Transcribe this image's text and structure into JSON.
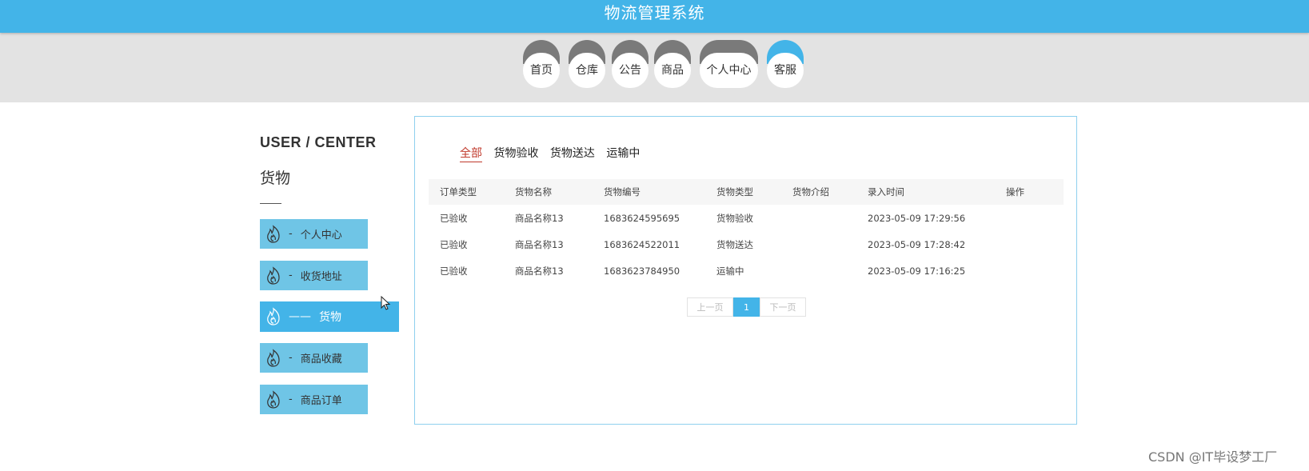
{
  "app_title": "物流管理系统",
  "nav": {
    "items": [
      "首页",
      "仓库",
      "公告",
      "商品",
      "个人中心",
      "客服"
    ],
    "active_index": 5
  },
  "sidebar": {
    "heading": "USER / CENTER",
    "title": "货物",
    "items": [
      {
        "label": "个人中心",
        "active": false
      },
      {
        "label": "收货地址",
        "active": false
      },
      {
        "label": "货物",
        "active": true
      },
      {
        "label": "商品收藏",
        "active": false
      },
      {
        "label": "商品订单",
        "active": false
      }
    ]
  },
  "tabs": [
    "全部",
    "货物验收",
    "货物送达",
    "运输中"
  ],
  "active_tab": 0,
  "table": {
    "headers": [
      "订单类型",
      "货物名称",
      "货物编号",
      "货物类型",
      "货物介绍",
      "录入时间",
      "操作"
    ],
    "rows": [
      [
        "已验收",
        "商品名称13",
        "1683624595695",
        "货物验收",
        "",
        "2023-05-09 17:29:56",
        ""
      ],
      [
        "已验收",
        "商品名称13",
        "1683624522011",
        "货物送达",
        "",
        "2023-05-09 17:28:42",
        ""
      ],
      [
        "已验收",
        "商品名称13",
        "1683623784950",
        "运输中",
        "",
        "2023-05-09 17:16:25",
        ""
      ]
    ]
  },
  "pagination": {
    "prev": "上一页",
    "current": "1",
    "next": "下一页"
  },
  "watermark": "CSDN @IT毕设梦工厂",
  "colors": {
    "primary": "#43b4e8",
    "nav_cap": "#7a7a7a",
    "side_button": "#6fc5e6",
    "active_tab": "#c0392b",
    "band": "#e3e3e3"
  }
}
